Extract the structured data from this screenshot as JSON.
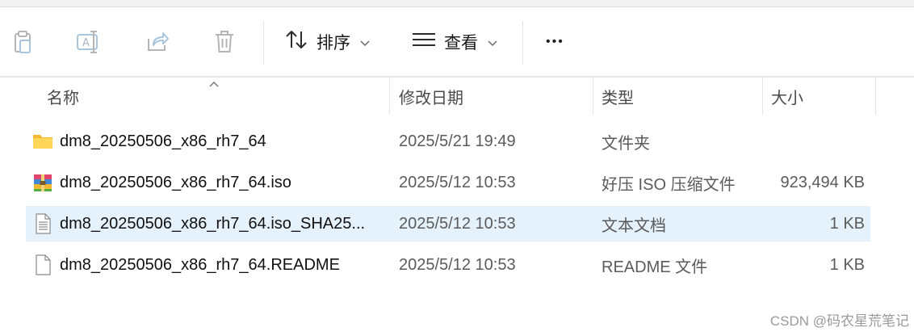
{
  "toolbar": {
    "sort_label": "排序",
    "view_label": "查看",
    "more_label": "•••"
  },
  "columns": {
    "name": "名称",
    "modified": "修改日期",
    "type": "类型",
    "size": "大小"
  },
  "files": [
    {
      "name": "dm8_20250506_x86_rh7_64",
      "modified": "2025/5/21 19:49",
      "type": "文件夹",
      "size": "",
      "icon": "folder-icon"
    },
    {
      "name": "dm8_20250506_x86_rh7_64.iso",
      "modified": "2025/5/12 10:53",
      "type": "好压 ISO 压缩文件",
      "size": "923,494 KB",
      "icon": "archive-icon"
    },
    {
      "name": "dm8_20250506_x86_rh7_64.iso_SHA25...",
      "modified": "2025/5/12 10:53",
      "type": "文本文档",
      "size": "1 KB",
      "icon": "text-document-icon",
      "selected": true
    },
    {
      "name": "dm8_20250506_x86_rh7_64.README",
      "modified": "2025/5/12 10:53",
      "type": "README 文件",
      "size": "1 KB",
      "icon": "blank-file-icon"
    }
  ],
  "watermark": "CSDN @码农星荒笔记"
}
